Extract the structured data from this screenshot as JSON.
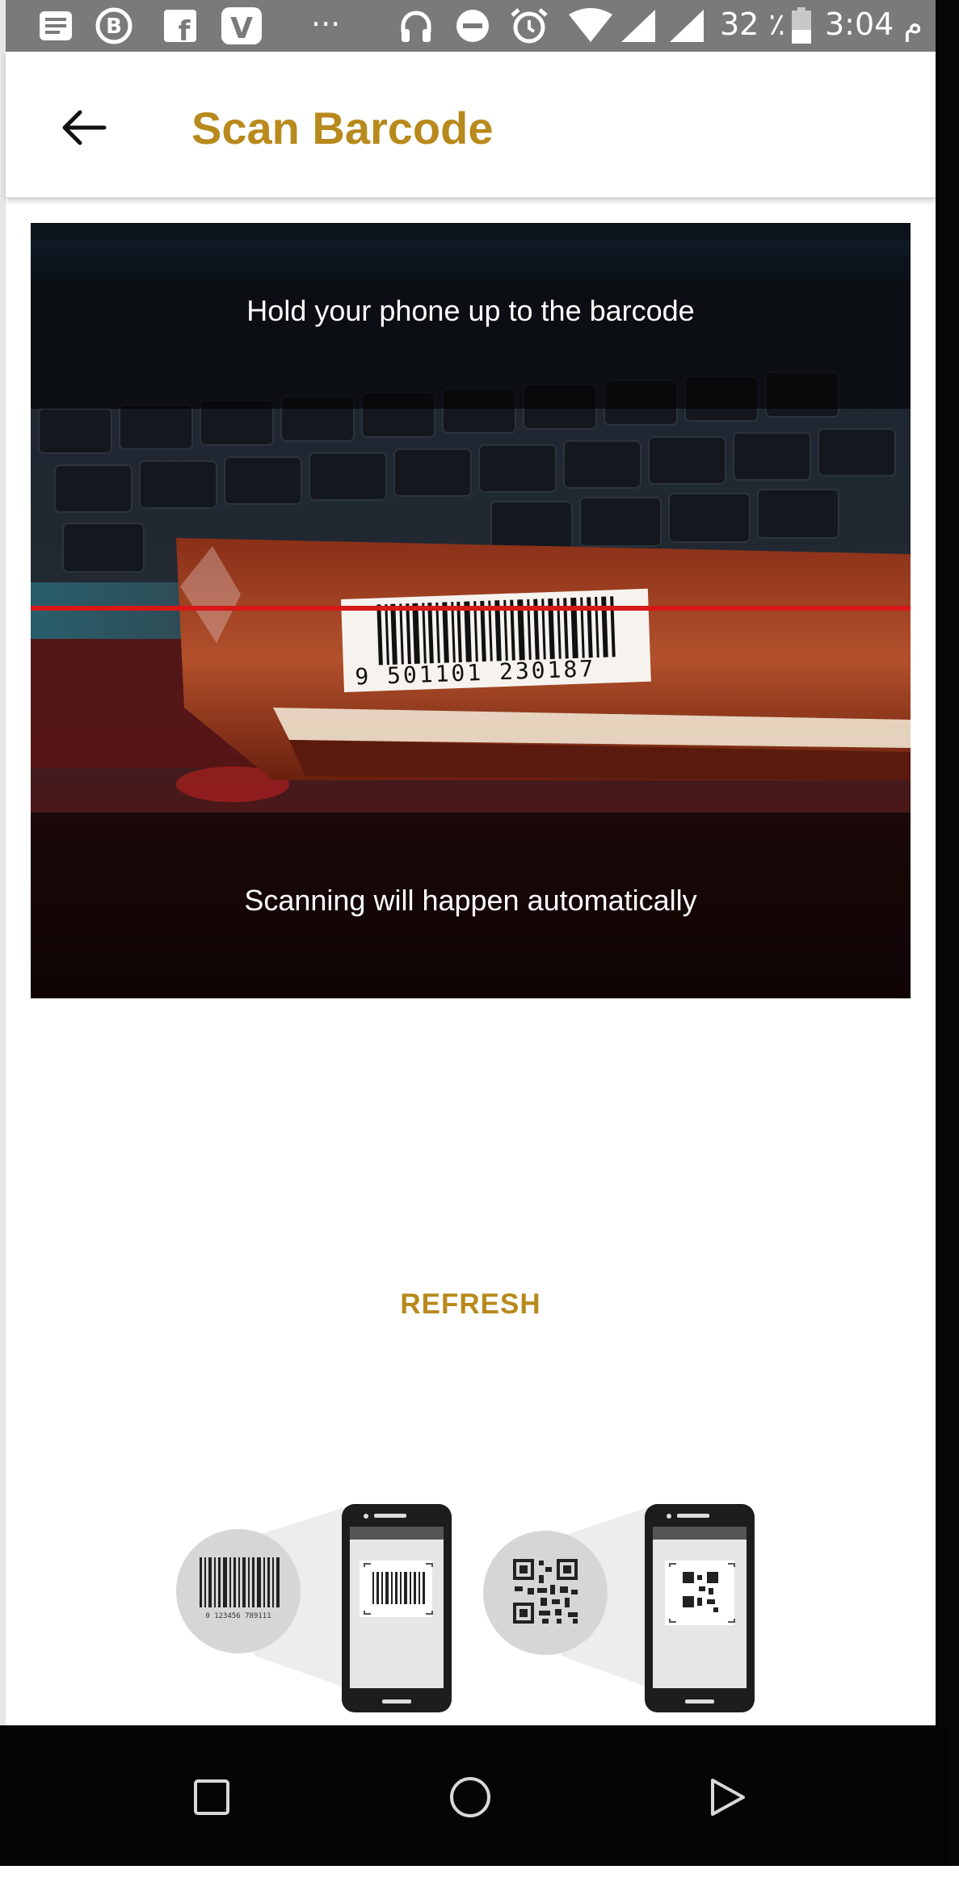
{
  "status_bar": {
    "battery_percent": "32 ٪",
    "time": "3:04 م",
    "overflow_indicator": "···",
    "icons": [
      "notes-icon",
      "b-icon",
      "facebook-icon",
      "v-icon",
      "headphones-icon",
      "do-not-disturb-icon",
      "alarm-icon",
      "wifi-icon",
      "signal-icon",
      "signal-icon",
      "battery-icon"
    ]
  },
  "app_bar": {
    "title": "Scan Barcode",
    "back_icon": "arrow-left-icon"
  },
  "scanner": {
    "top_hint": "Hold your phone up to the barcode",
    "bottom_hint": "Scanning will happen automatically",
    "barcode_number": "9 501101 230187",
    "scan_line_color": "#d81818"
  },
  "actions": {
    "refresh_label": "REFRESH"
  },
  "illustration": {
    "barcode_caption": "0 123456 789111"
  },
  "nav_bar": {
    "recents_icon": "square-icon",
    "home_icon": "circle-icon",
    "back_icon": "triangle-icon"
  },
  "colors": {
    "accent": "#b8891c",
    "status_bar": "#7a7a7a",
    "nav_bar": "#050505"
  }
}
